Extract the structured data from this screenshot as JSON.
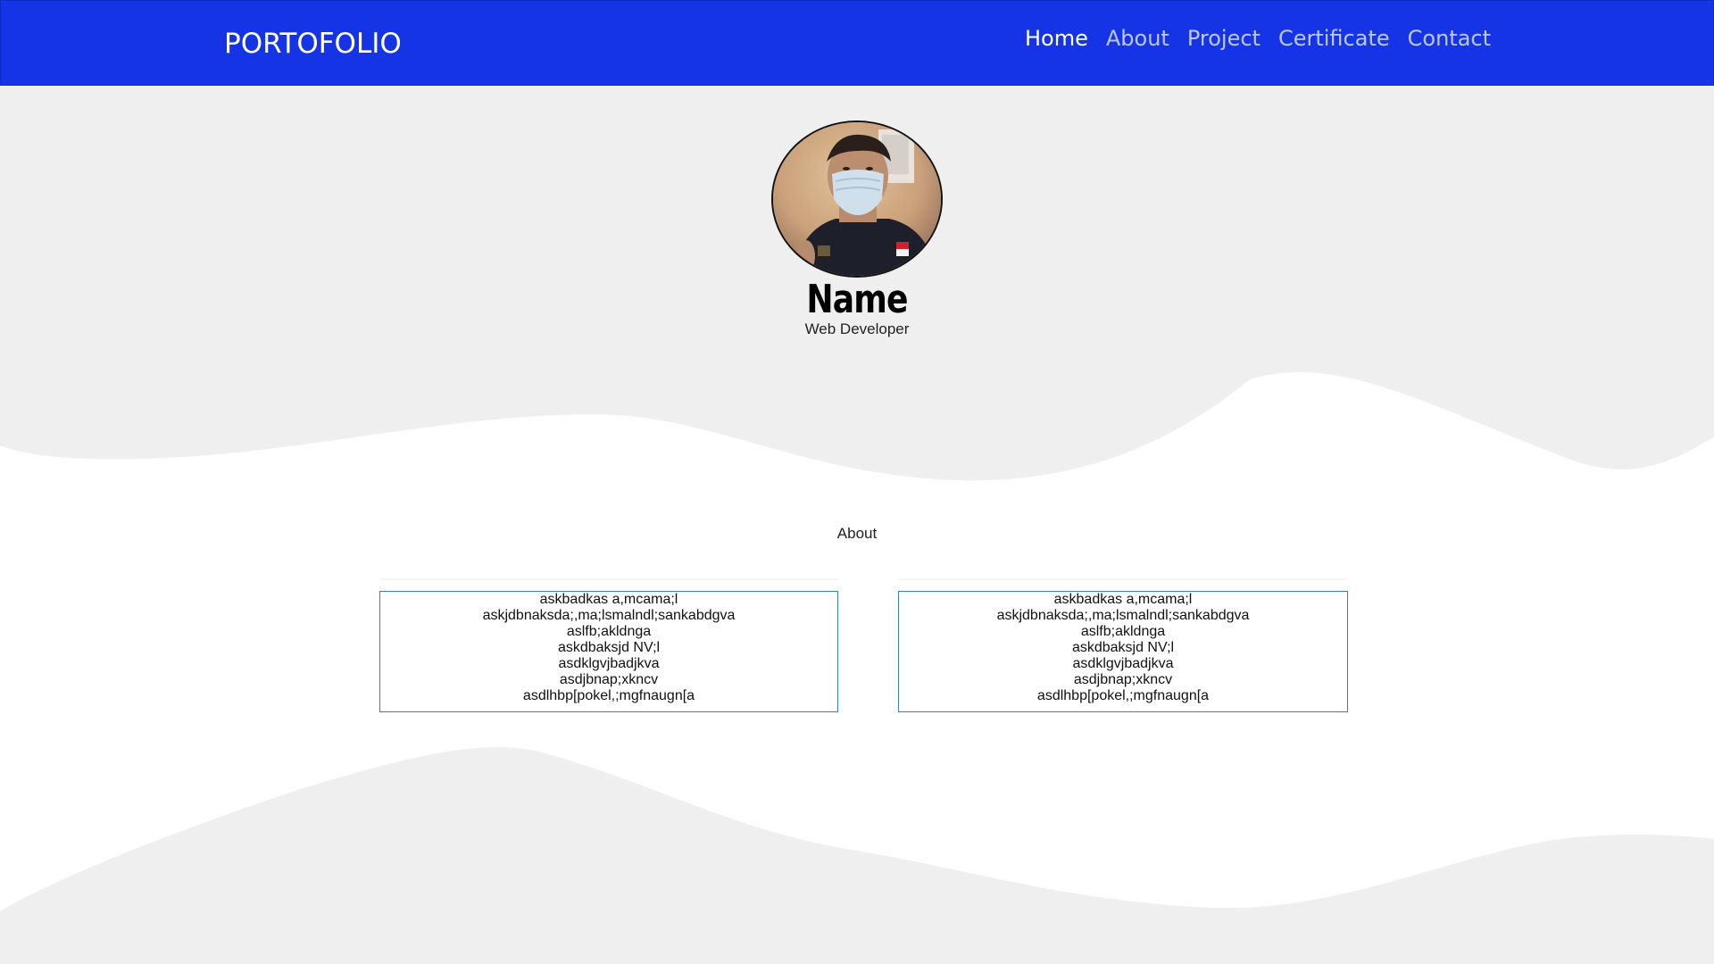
{
  "navbar": {
    "brand": "PORTOFOLIO",
    "links": [
      {
        "label": "Home",
        "active": true
      },
      {
        "label": "About",
        "active": false
      },
      {
        "label": "Project",
        "active": false
      },
      {
        "label": "Certificate",
        "active": false
      },
      {
        "label": "Contact",
        "active": false
      }
    ],
    "background_color": "#1434e6"
  },
  "hero": {
    "name": "Name",
    "role": "Web Developer",
    "avatar_alt": "profile photo"
  },
  "about": {
    "title": "About",
    "cards": [
      {
        "lines": [
          "askbadkas a,mcama;l",
          "askjdbnaksda;,ma;lsmalndl;sankabdgva",
          "aslfb;akldnga",
          "askdbaksjd NV;l",
          "asdklgvjbadjkva",
          "asdjbnap;xkncv",
          "asdlhbp[pokel,;mgfnaugn[a"
        ]
      },
      {
        "lines": [
          "askbadkas a,mcama;l",
          "askjdbnaksda;,ma;lsmalndl;sankabdgva",
          "aslfb;akldnga",
          "askdbaksjd NV;l",
          "asdklgvjbadjkva",
          "asdjbnap;xkncv",
          "asdlhbp[pokel,;mgfnaugn[a"
        ]
      }
    ]
  },
  "colors": {
    "page_background": "#efefef",
    "section_background": "#ffffff",
    "card_border": "#3a7fc4"
  }
}
